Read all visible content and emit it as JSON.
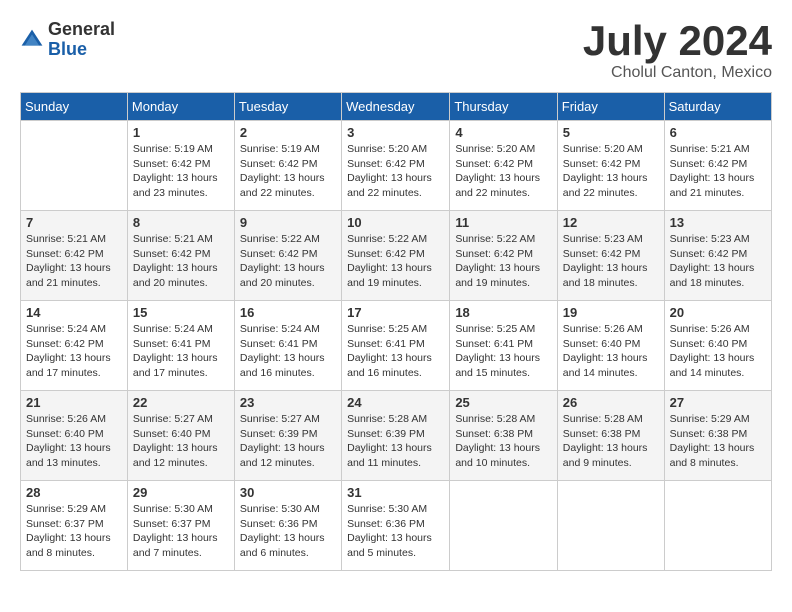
{
  "header": {
    "logo_general": "General",
    "logo_blue": "Blue",
    "month_title": "July 2024",
    "location": "Cholul Canton, Mexico"
  },
  "weekdays": [
    "Sunday",
    "Monday",
    "Tuesday",
    "Wednesday",
    "Thursday",
    "Friday",
    "Saturday"
  ],
  "weeks": [
    [
      {
        "day": "",
        "sunrise": "",
        "sunset": "",
        "daylight": ""
      },
      {
        "day": "1",
        "sunrise": "Sunrise: 5:19 AM",
        "sunset": "Sunset: 6:42 PM",
        "daylight": "Daylight: 13 hours and 23 minutes."
      },
      {
        "day": "2",
        "sunrise": "Sunrise: 5:19 AM",
        "sunset": "Sunset: 6:42 PM",
        "daylight": "Daylight: 13 hours and 22 minutes."
      },
      {
        "day": "3",
        "sunrise": "Sunrise: 5:20 AM",
        "sunset": "Sunset: 6:42 PM",
        "daylight": "Daylight: 13 hours and 22 minutes."
      },
      {
        "day": "4",
        "sunrise": "Sunrise: 5:20 AM",
        "sunset": "Sunset: 6:42 PM",
        "daylight": "Daylight: 13 hours and 22 minutes."
      },
      {
        "day": "5",
        "sunrise": "Sunrise: 5:20 AM",
        "sunset": "Sunset: 6:42 PM",
        "daylight": "Daylight: 13 hours and 22 minutes."
      },
      {
        "day": "6",
        "sunrise": "Sunrise: 5:21 AM",
        "sunset": "Sunset: 6:42 PM",
        "daylight": "Daylight: 13 hours and 21 minutes."
      }
    ],
    [
      {
        "day": "7",
        "sunrise": "Sunrise: 5:21 AM",
        "sunset": "Sunset: 6:42 PM",
        "daylight": "Daylight: 13 hours and 21 minutes."
      },
      {
        "day": "8",
        "sunrise": "Sunrise: 5:21 AM",
        "sunset": "Sunset: 6:42 PM",
        "daylight": "Daylight: 13 hours and 20 minutes."
      },
      {
        "day": "9",
        "sunrise": "Sunrise: 5:22 AM",
        "sunset": "Sunset: 6:42 PM",
        "daylight": "Daylight: 13 hours and 20 minutes."
      },
      {
        "day": "10",
        "sunrise": "Sunrise: 5:22 AM",
        "sunset": "Sunset: 6:42 PM",
        "daylight": "Daylight: 13 hours and 19 minutes."
      },
      {
        "day": "11",
        "sunrise": "Sunrise: 5:22 AM",
        "sunset": "Sunset: 6:42 PM",
        "daylight": "Daylight: 13 hours and 19 minutes."
      },
      {
        "day": "12",
        "sunrise": "Sunrise: 5:23 AM",
        "sunset": "Sunset: 6:42 PM",
        "daylight": "Daylight: 13 hours and 18 minutes."
      },
      {
        "day": "13",
        "sunrise": "Sunrise: 5:23 AM",
        "sunset": "Sunset: 6:42 PM",
        "daylight": "Daylight: 13 hours and 18 minutes."
      }
    ],
    [
      {
        "day": "14",
        "sunrise": "Sunrise: 5:24 AM",
        "sunset": "Sunset: 6:42 PM",
        "daylight": "Daylight: 13 hours and 17 minutes."
      },
      {
        "day": "15",
        "sunrise": "Sunrise: 5:24 AM",
        "sunset": "Sunset: 6:41 PM",
        "daylight": "Daylight: 13 hours and 17 minutes."
      },
      {
        "day": "16",
        "sunrise": "Sunrise: 5:24 AM",
        "sunset": "Sunset: 6:41 PM",
        "daylight": "Daylight: 13 hours and 16 minutes."
      },
      {
        "day": "17",
        "sunrise": "Sunrise: 5:25 AM",
        "sunset": "Sunset: 6:41 PM",
        "daylight": "Daylight: 13 hours and 16 minutes."
      },
      {
        "day": "18",
        "sunrise": "Sunrise: 5:25 AM",
        "sunset": "Sunset: 6:41 PM",
        "daylight": "Daylight: 13 hours and 15 minutes."
      },
      {
        "day": "19",
        "sunrise": "Sunrise: 5:26 AM",
        "sunset": "Sunset: 6:40 PM",
        "daylight": "Daylight: 13 hours and 14 minutes."
      },
      {
        "day": "20",
        "sunrise": "Sunrise: 5:26 AM",
        "sunset": "Sunset: 6:40 PM",
        "daylight": "Daylight: 13 hours and 14 minutes."
      }
    ],
    [
      {
        "day": "21",
        "sunrise": "Sunrise: 5:26 AM",
        "sunset": "Sunset: 6:40 PM",
        "daylight": "Daylight: 13 hours and 13 minutes."
      },
      {
        "day": "22",
        "sunrise": "Sunrise: 5:27 AM",
        "sunset": "Sunset: 6:40 PM",
        "daylight": "Daylight: 13 hours and 12 minutes."
      },
      {
        "day": "23",
        "sunrise": "Sunrise: 5:27 AM",
        "sunset": "Sunset: 6:39 PM",
        "daylight": "Daylight: 13 hours and 12 minutes."
      },
      {
        "day": "24",
        "sunrise": "Sunrise: 5:28 AM",
        "sunset": "Sunset: 6:39 PM",
        "daylight": "Daylight: 13 hours and 11 minutes."
      },
      {
        "day": "25",
        "sunrise": "Sunrise: 5:28 AM",
        "sunset": "Sunset: 6:38 PM",
        "daylight": "Daylight: 13 hours and 10 minutes."
      },
      {
        "day": "26",
        "sunrise": "Sunrise: 5:28 AM",
        "sunset": "Sunset: 6:38 PM",
        "daylight": "Daylight: 13 hours and 9 minutes."
      },
      {
        "day": "27",
        "sunrise": "Sunrise: 5:29 AM",
        "sunset": "Sunset: 6:38 PM",
        "daylight": "Daylight: 13 hours and 8 minutes."
      }
    ],
    [
      {
        "day": "28",
        "sunrise": "Sunrise: 5:29 AM",
        "sunset": "Sunset: 6:37 PM",
        "daylight": "Daylight: 13 hours and 8 minutes."
      },
      {
        "day": "29",
        "sunrise": "Sunrise: 5:30 AM",
        "sunset": "Sunset: 6:37 PM",
        "daylight": "Daylight: 13 hours and 7 minutes."
      },
      {
        "day": "30",
        "sunrise": "Sunrise: 5:30 AM",
        "sunset": "Sunset: 6:36 PM",
        "daylight": "Daylight: 13 hours and 6 minutes."
      },
      {
        "day": "31",
        "sunrise": "Sunrise: 5:30 AM",
        "sunset": "Sunset: 6:36 PM",
        "daylight": "Daylight: 13 hours and 5 minutes."
      },
      {
        "day": "",
        "sunrise": "",
        "sunset": "",
        "daylight": ""
      },
      {
        "day": "",
        "sunrise": "",
        "sunset": "",
        "daylight": ""
      },
      {
        "day": "",
        "sunrise": "",
        "sunset": "",
        "daylight": ""
      }
    ]
  ]
}
